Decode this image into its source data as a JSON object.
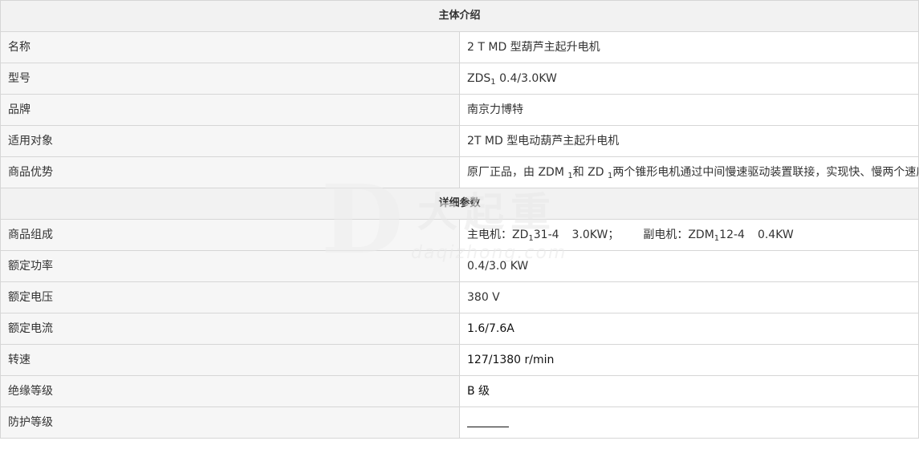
{
  "sections": {
    "intro_title": "主体介绍",
    "detail_title": "详细参数"
  },
  "intro": [
    {
      "label": "名称",
      "value": "2 T MD 型葫芦主起升电机"
    },
    {
      "label": "型号",
      "value_prefix": "ZDS",
      "value_sub": "1",
      "value_suffix": " 0.4/3.0KW"
    },
    {
      "label": "品牌",
      "value": "南京力博特"
    },
    {
      "label": "适用对象",
      "value": "2T MD 型电动葫芦主起升电机"
    },
    {
      "label": "商品优势",
      "value_a": "原厂正品，由 ZDM ",
      "value_sub_a": "1",
      "value_b": "和 ZD ",
      "value_sub_b": "1",
      "value_c": "两个锥形电机通过中间慢速驱动装置联接，实现快、慢两个速度。"
    }
  ],
  "details": [
    {
      "label": "商品组成",
      "main_a": "主电机：ZD",
      "main_sub": "1",
      "main_b": "31-4",
      "main_power": "3.0KW；",
      "aux_a": "副电机：ZDM",
      "aux_sub": "1",
      "aux_b": "12-4",
      "aux_power": "0.4KW"
    },
    {
      "label": "额定功率",
      "value": "0.4/3.0 KW"
    },
    {
      "label": "额定电压",
      "value": "380 V"
    },
    {
      "label": "额定电流",
      "value": "1.6/7.6A"
    },
    {
      "label": "转速",
      "value": "127/1380 r/min"
    },
    {
      "label": "绝缘等级",
      "value": "B 级"
    },
    {
      "label": "防护等级",
      "value": ""
    }
  ],
  "watermark": {
    "logo_letter": "D",
    "brand_cn": "大起重",
    "url": "daqizhong.com"
  }
}
